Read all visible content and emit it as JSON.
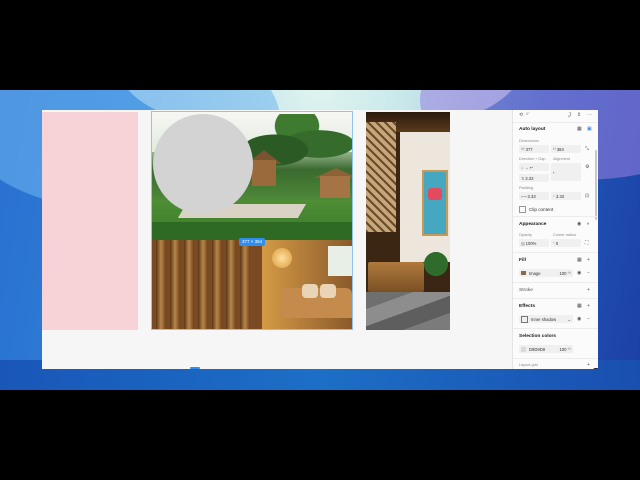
{
  "canvas": {
    "selection_size": "377 × 384"
  },
  "panel": {
    "top_value": "0°",
    "auto_layout": {
      "title": "Auto layout",
      "dimensions_label": "Dimensions",
      "width": "377",
      "height": "384",
      "direction_label": "Direction + Gap",
      "alignment_label": "Alignment",
      "gap": "3.33",
      "padding_label": "Padding",
      "padding_h": "3.33",
      "padding_v": "3.33",
      "clip_label": "Clip content"
    },
    "appearance": {
      "title": "Appearance",
      "opacity_label": "Opacity",
      "radius_label": "Corner radius",
      "opacity": "100%",
      "radius": "0"
    },
    "fill": {
      "title": "Fill",
      "type": "Image",
      "opacity": "100",
      "unit": "%"
    },
    "stroke": {
      "title": "Stroke"
    },
    "effects": {
      "title": "Effects",
      "type": "Inner shadow"
    },
    "selection_colors": {
      "title": "Selection colors",
      "hex": "D9D9D9",
      "opacity": "100",
      "unit": "%"
    },
    "layout_grid": {
      "title": "Layout grid"
    },
    "colors": {
      "accent": "#2f8ef0",
      "swatch_gray": "#d9d9d9"
    }
  }
}
